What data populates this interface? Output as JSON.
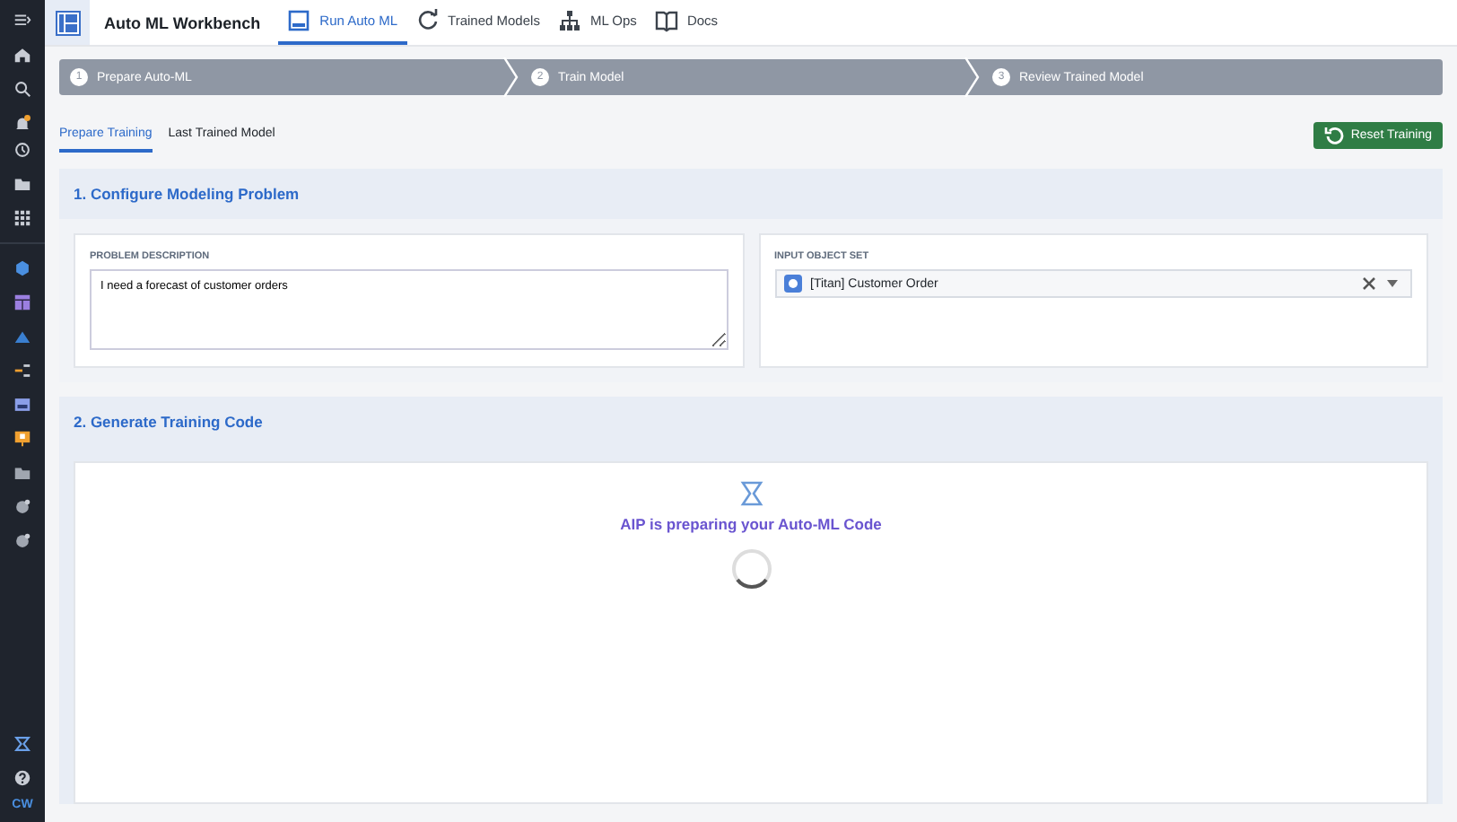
{
  "app": {
    "title": "Auto ML Workbench"
  },
  "nav_tabs": [
    {
      "label": "Run Auto ML",
      "kind": "panel",
      "selected": true
    },
    {
      "label": "Trained Models",
      "kind": "models",
      "selected": false
    },
    {
      "label": "ML Ops",
      "kind": "ops",
      "selected": false
    },
    {
      "label": "Docs",
      "kind": "docs",
      "selected": false
    }
  ],
  "steps": [
    {
      "number": "1",
      "label": "Prepare Auto-ML"
    },
    {
      "number": "2",
      "label": "Train Model"
    },
    {
      "number": "3",
      "label": "Review Trained Model"
    }
  ],
  "sub_tabs": [
    {
      "label": "Prepare Training",
      "selected": true
    },
    {
      "label": "Last Trained Model",
      "selected": false
    }
  ],
  "reset_button": "Reset Training",
  "sections": [
    {
      "title": "1. Configure Modeling Problem",
      "kind": "form",
      "problem": {
        "label": "PROBLEM DESCRIPTION",
        "value": "I need a forecast of customer orders"
      },
      "input": {
        "label": "INPUT OBJECT SET",
        "value": "[Titan] Customer Order"
      }
    },
    {
      "title": "2. Generate Training Code",
      "kind": "loading",
      "message": "AIP is preparing your Auto-ML Code"
    }
  ],
  "user_initials": "CW"
}
